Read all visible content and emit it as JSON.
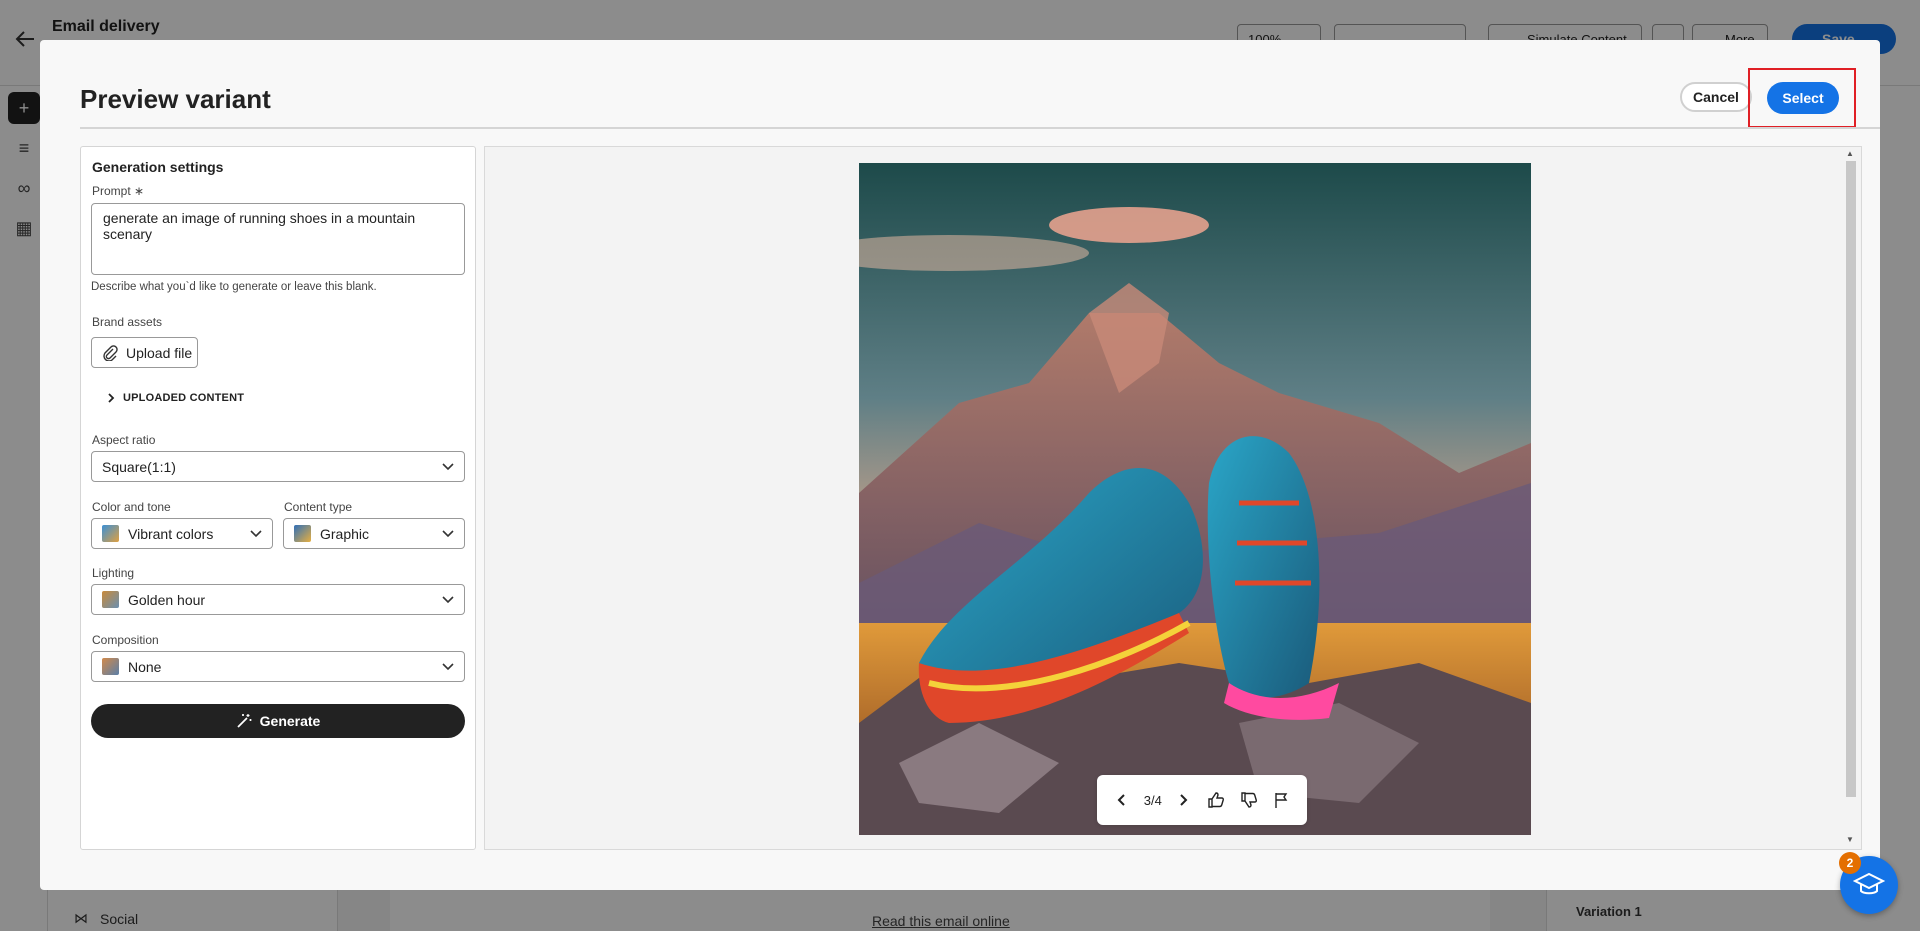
{
  "background": {
    "title": "Email delivery",
    "zoom": "100%",
    "simulate_label": "Simulate Content",
    "more_label": "More",
    "save_label": "Save",
    "social_label": "Social",
    "read_online": "Read this email online",
    "variation_label": "Variation 1"
  },
  "dialog": {
    "title": "Preview variant",
    "cancel_label": "Cancel",
    "select_label": "Select"
  },
  "settings": {
    "heading": "Generation settings",
    "prompt_label": "Prompt",
    "prompt_required": "∗",
    "prompt_value": "generate an image of running shoes in a mountain scenary",
    "prompt_help": "Describe what you`d like to generate or leave this blank.",
    "brand_assets_label": "Brand assets",
    "upload_label": "Upload file",
    "uploaded_content_label": "UPLOADED CONTENT",
    "aspect_ratio_label": "Aspect ratio",
    "aspect_ratio_value": "Square(1:1)",
    "color_tone_label": "Color and tone",
    "color_tone_value": "Vibrant colors",
    "content_type_label": "Content type",
    "content_type_value": "Graphic",
    "lighting_label": "Lighting",
    "lighting_value": "Golden hour",
    "composition_label": "Composition",
    "composition_value": "None",
    "generate_label": "Generate"
  },
  "preview": {
    "counter": "3/4"
  },
  "help_badge": "2",
  "colors": {
    "accent": "#1473e6",
    "highlight": "#e01f25",
    "dark_button": "#222222",
    "badge": "#e46f00"
  },
  "icons": [
    "back-arrow-icon",
    "add-icon",
    "layers-icon",
    "link-icon",
    "grid-icon",
    "attachment-icon",
    "chevron-right-icon",
    "chevron-down-icon",
    "wand-icon",
    "chevron-left-icon",
    "thumbs-up-icon",
    "thumbs-down-icon",
    "flag-icon",
    "graduation-cap-icon"
  ]
}
